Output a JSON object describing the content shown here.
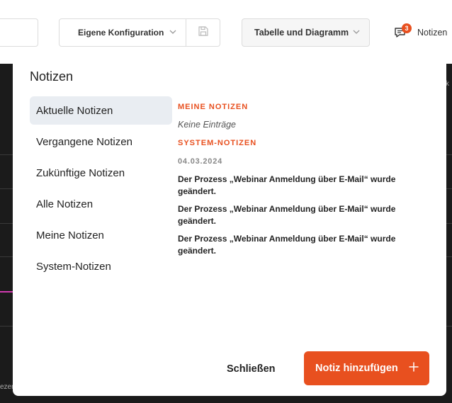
{
  "toolbar": {
    "config_select": "Eigene Konfiguration",
    "view_select": "Tabelle und Diagramm",
    "notes_label": "Notizen",
    "notes_count": "3"
  },
  "background": {
    "left_fragment": "ezen",
    "right_fragment": "k"
  },
  "modal": {
    "title": "Notizen",
    "nav": [
      {
        "label": "Aktuelle Notizen",
        "active": true
      },
      {
        "label": "Vergangene Notizen",
        "active": false
      },
      {
        "label": "Zukünftige Notizen",
        "active": false
      },
      {
        "label": "Alle Notizen",
        "active": false
      },
      {
        "label": "Meine Notizen",
        "active": false
      },
      {
        "label": "System-Notizen",
        "active": false
      }
    ],
    "my_notes_heading": "Meine Notizen",
    "my_notes_empty": "Keine Einträge",
    "system_notes_heading": "System-Notizen",
    "system_date": "04.03.2024",
    "system_entries": [
      "Der Prozess „Webinar Anmeldung über E-Mail“ wurde geändert.",
      "Der Prozess „Webinar Anmeldung über E-Mail“ wurde geändert.",
      "Der Prozess „Webinar Anmeldung über E-Mail“ wurde geändert."
    ],
    "close_label": "Schließen",
    "add_label": "Notiz hinzufügen"
  },
  "colors": {
    "accent": "#e8501f",
    "active_nav_bg": "#e9edf2"
  }
}
